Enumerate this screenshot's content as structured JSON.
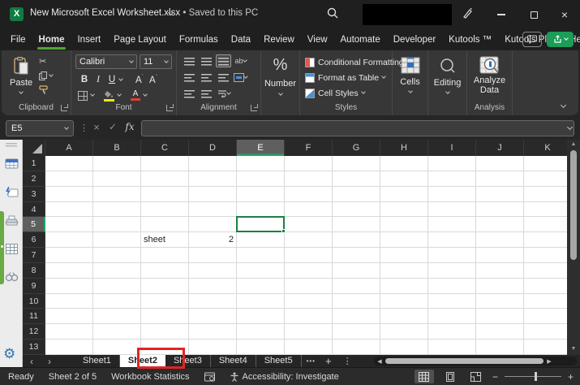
{
  "window": {
    "title": "New Microsoft Excel Worksheet.xlsx",
    "separator": "•",
    "saved_status": "Saved to this PC"
  },
  "menubar": {
    "items": [
      "File",
      "Home",
      "Insert",
      "Page Layout",
      "Formulas",
      "Data",
      "Review",
      "View",
      "Automate",
      "Developer",
      "Kutools ™",
      "Kutools Plus",
      "Help"
    ],
    "active_item": "Home"
  },
  "ribbon": {
    "clipboard": {
      "paste_label": "Paste",
      "group_label": "Clipboard"
    },
    "font": {
      "font_name": "Calibri",
      "font_size": "11",
      "bold": "B",
      "italic": "I",
      "underline": "U",
      "grow": "A",
      "shrink": "A",
      "color_a": "A",
      "group_label": "Font"
    },
    "alignment": {
      "orientation": "ab",
      "group_label": "Alignment"
    },
    "number": {
      "symbol": "%",
      "label": "Number"
    },
    "styles": {
      "items": [
        "Conditional Formatting",
        "Format as Table",
        "Cell Styles"
      ],
      "group_label": "Styles"
    },
    "cells": {
      "label": "Cells"
    },
    "editing": {
      "label": "Editing"
    },
    "analysis": {
      "button_label_line1": "Analyze",
      "button_label_line2": "Data",
      "group_label": "Analysis"
    }
  },
  "formula_bar": {
    "name_box_value": "E5",
    "fx_label": "fx",
    "formula_value": ""
  },
  "grid": {
    "columns": [
      "A",
      "B",
      "C",
      "D",
      "E",
      "F",
      "G",
      "H",
      "I",
      "J",
      "K"
    ],
    "visible_rows": 13,
    "selected_cell": "E5",
    "selected_column": "E",
    "selected_row": "5",
    "cells": [
      {
        "ref": "C6",
        "col": "C",
        "row": 6,
        "value": "sheet",
        "align": "left"
      },
      {
        "ref": "D6",
        "col": "D",
        "row": 6,
        "value": "2",
        "align": "right"
      }
    ]
  },
  "sheet_tabs": {
    "tabs": [
      "Sheet1",
      "Sheet2",
      "Sheet3",
      "Sheet4",
      "Sheet5"
    ],
    "active_tab": "Sheet2",
    "overflow_dots": "•••"
  },
  "status_bar": {
    "mode": "Ready",
    "sheet_position": "Sheet 2 of 5",
    "workbook_statistics": "Workbook Statistics",
    "accessibility": "Accessibility: Investigate"
  },
  "glyphs": {
    "excel_logo": "X",
    "close": "×",
    "cut": "✂",
    "cancel": "×",
    "enter": "✓",
    "more_dots": "⋮",
    "tab_prev": "‹",
    "tab_next": "›",
    "scroll_left": "◀",
    "scroll_right": "▶",
    "scroll_up": "▲",
    "scroll_down": "▼",
    "add_sheet": "+",
    "zoom_out": "−",
    "zoom_in": "+",
    "gear": "⚙"
  },
  "colors": {
    "excel_green": "#107c41",
    "selection_green": "#1a7f44",
    "home_underline": "#4ea72e",
    "share_button": "#1c9c58",
    "annotation_red": "#e02424",
    "fill_color_swatch": "#ffe600",
    "font_color_swatch": "#e03e2d",
    "header_highlight_green": "#21a366"
  }
}
